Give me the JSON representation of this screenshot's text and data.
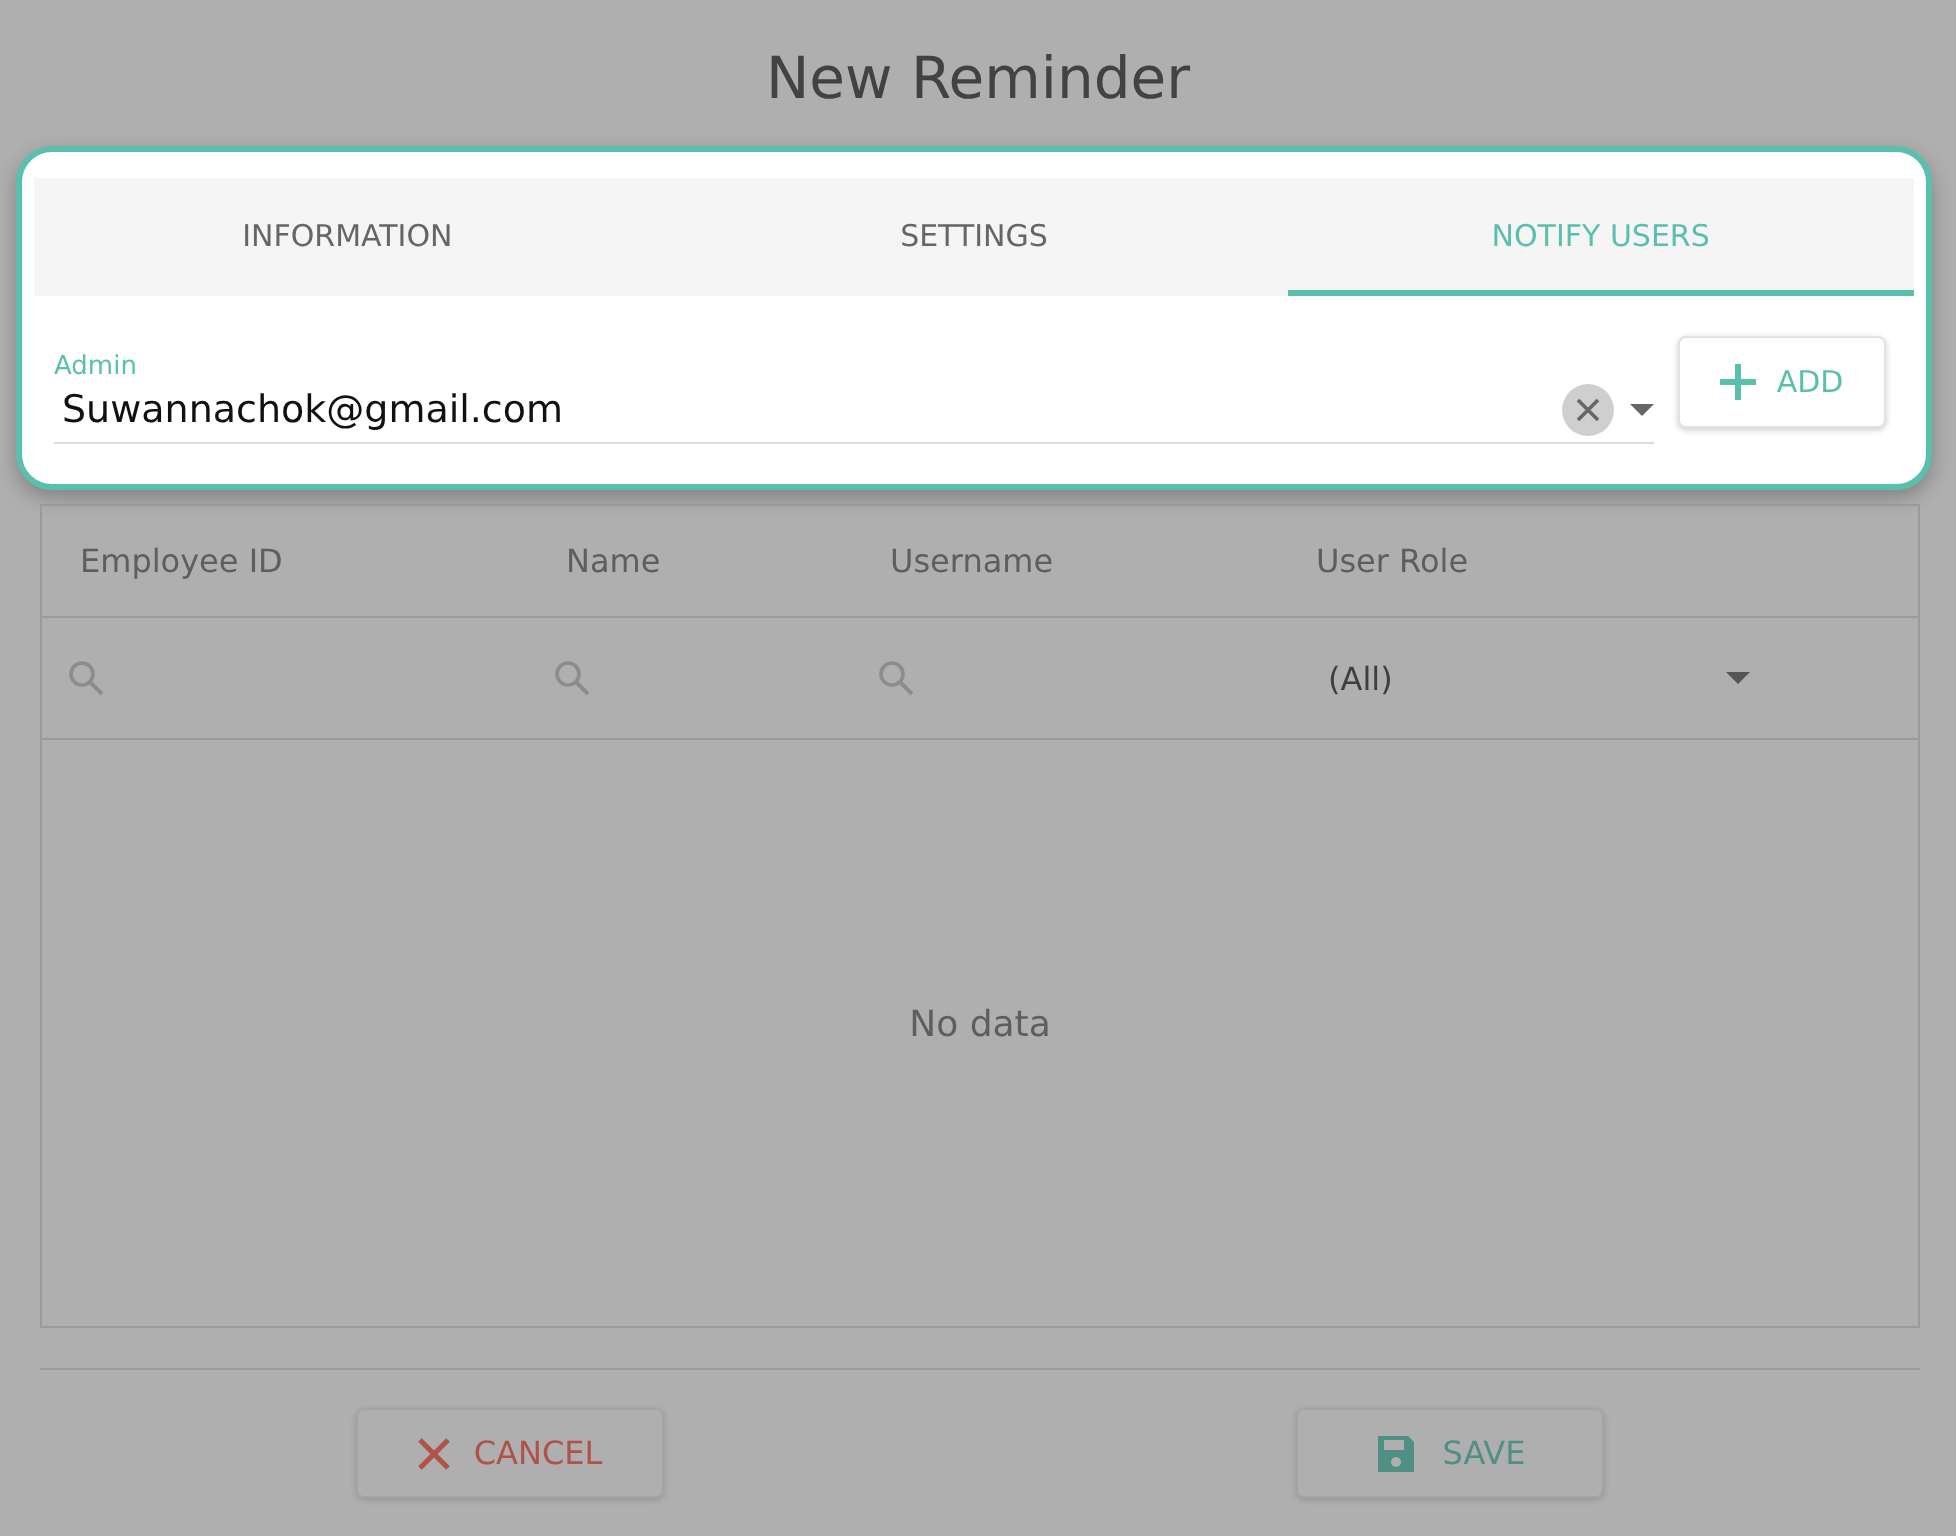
{
  "dialog": {
    "title": "New Reminder"
  },
  "tabs": [
    {
      "label": "INFORMATION",
      "selected": false
    },
    {
      "label": "SETTINGS",
      "selected": false
    },
    {
      "label": "NOTIFY USERS",
      "selected": true
    }
  ],
  "user_field": {
    "label": "Admin",
    "value": "Suwannachok@gmail.com"
  },
  "add_button": {
    "label": "ADD"
  },
  "table": {
    "columns": [
      "Employee ID",
      "Name",
      "Username",
      "User Role"
    ],
    "filters": [
      {
        "kind": "search"
      },
      {
        "kind": "search"
      },
      {
        "kind": "search"
      },
      {
        "kind": "select",
        "value": "(All)"
      }
    ],
    "empty_text": "No data"
  },
  "buttons": [
    {
      "kind": "cancel",
      "label": "CANCEL"
    },
    {
      "kind": "save",
      "label": "SAVE"
    }
  ]
}
